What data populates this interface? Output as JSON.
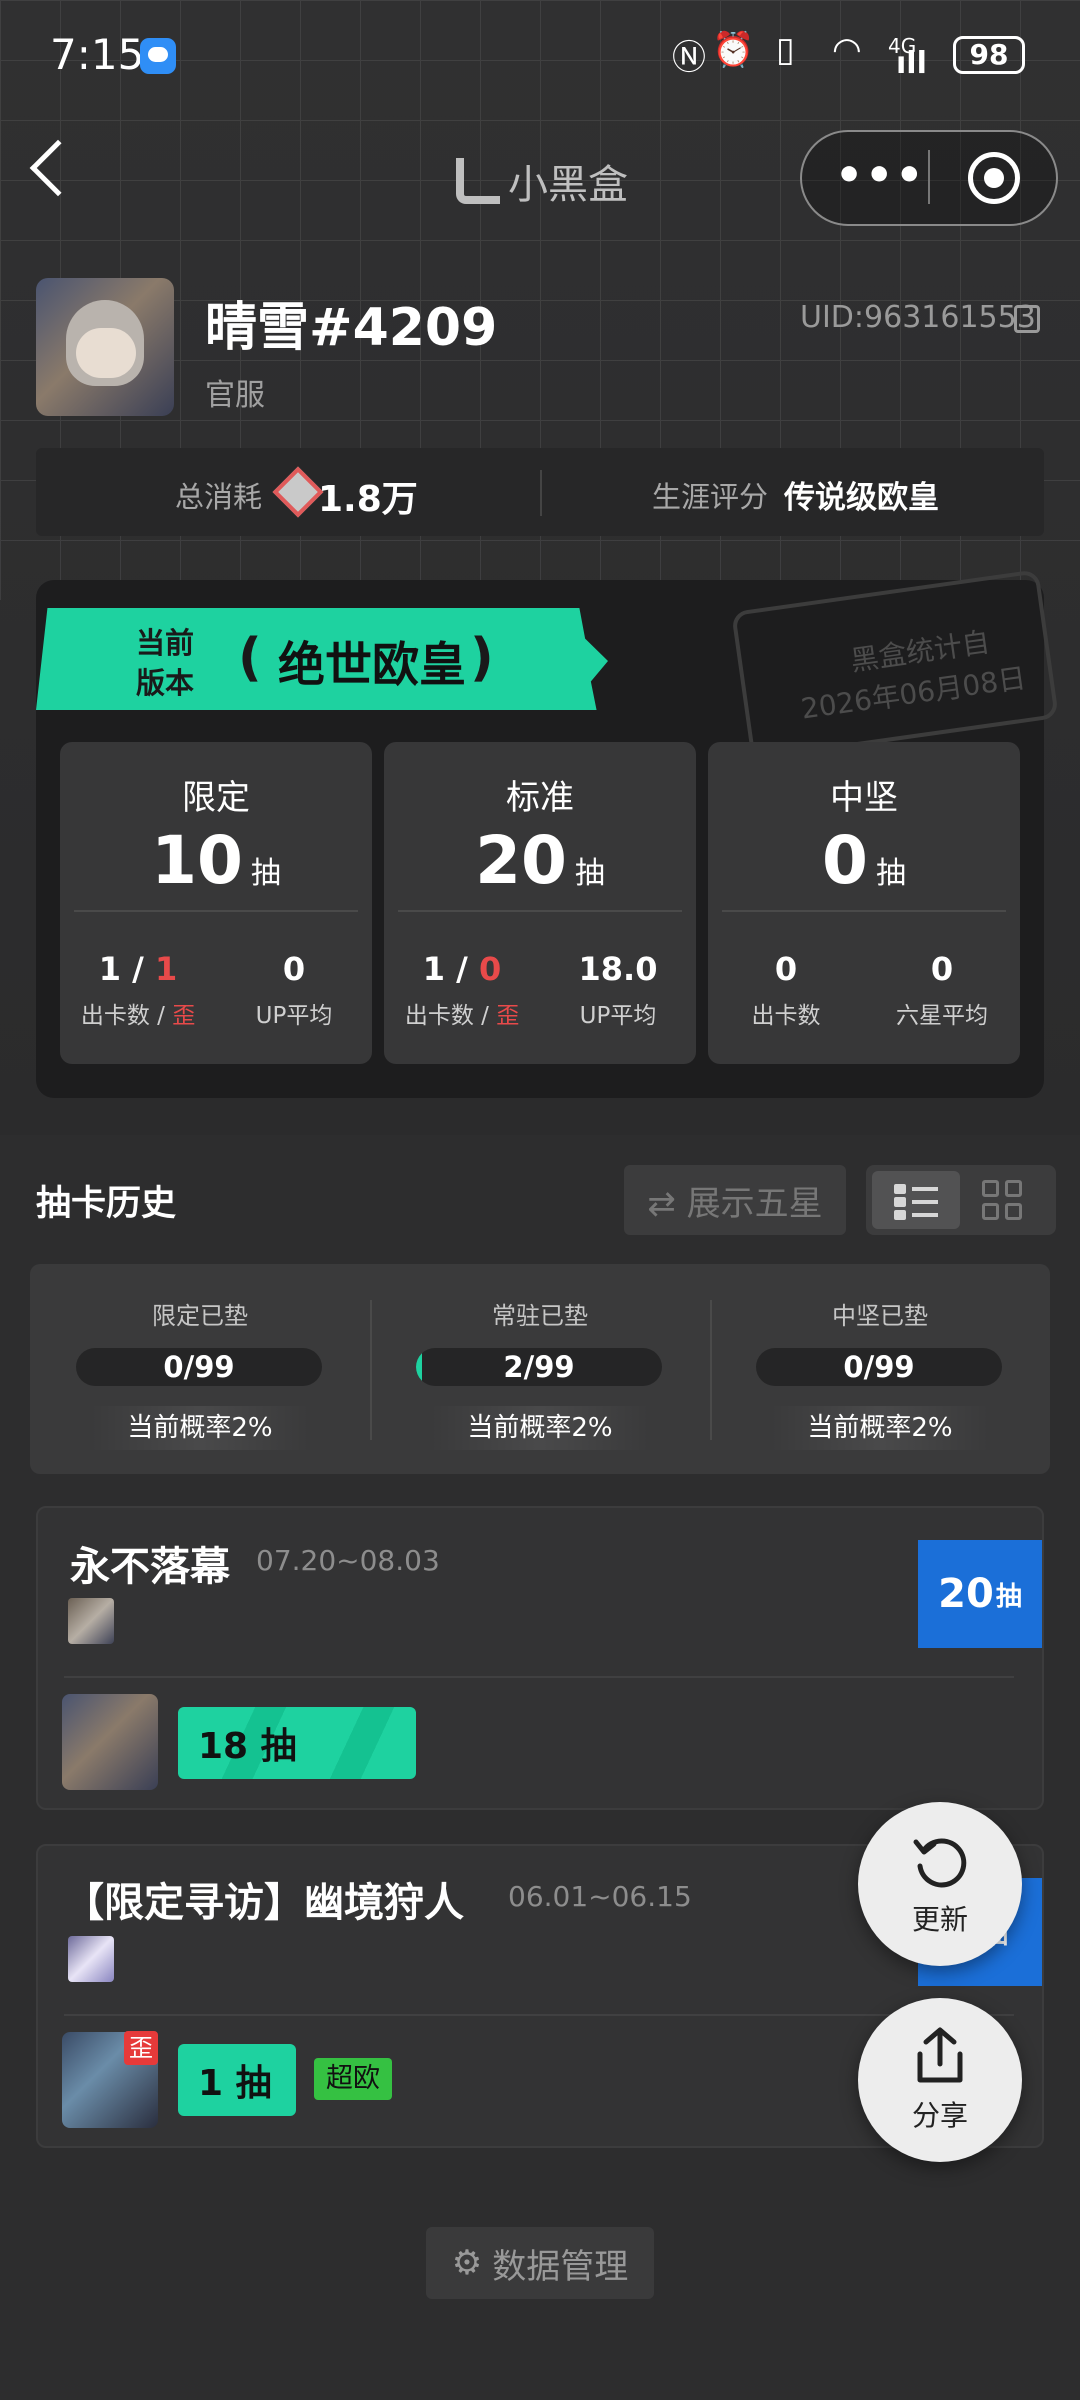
{
  "status": {
    "time": "7:15",
    "battery": "98",
    "net": "4G",
    "signal": "ıll"
  },
  "nav": {
    "title": "小黑盒",
    "more": "•••"
  },
  "profile": {
    "name": "晴雪#4209",
    "server": "官服",
    "uid": "UID:963161553"
  },
  "summary": {
    "cost_label": "总消耗",
    "cost_value": "1.8万",
    "career_label": "生涯评分",
    "career_value": "传说级欧皇"
  },
  "version": {
    "label_line1": "当前",
    "label_line2": "版本",
    "title": "绝世欧皇",
    "stamp_line1": "黑盒统计自",
    "stamp_line2": "2026年06月08日"
  },
  "pools": [
    {
      "name": "限定",
      "pulls": "10",
      "unit": "抽",
      "a_val": "1",
      "a_sep": " / ",
      "a_red": "1",
      "a_cap": "出卡数 / ",
      "a_cap_red": "歪",
      "b_val": "0",
      "b_cap": "UP平均"
    },
    {
      "name": "标准",
      "pulls": "20",
      "unit": "抽",
      "a_val": "1",
      "a_sep": " / ",
      "a_red": "0",
      "a_cap": "出卡数 / ",
      "a_cap_red": "歪",
      "b_val": "18.0",
      "b_cap": "UP平均"
    },
    {
      "name": "中坚",
      "pulls": "0",
      "unit": "抽",
      "a_val": "0",
      "a_sep": "",
      "a_red": "",
      "a_cap": "出卡数",
      "a_cap_red": "",
      "b_val": "0",
      "b_cap": "六星平均"
    }
  ],
  "history": {
    "title": "抽卡历史",
    "show_five": "⇄ 展示五星",
    "data_manage": "数据管理"
  },
  "pity": [
    {
      "label": "限定已垫",
      "value": "0/99",
      "progress": 0,
      "rate": "当前概率2%"
    },
    {
      "label": "常驻已垫",
      "value": "2/99",
      "progress": 0.02,
      "rate": "当前概率2%"
    },
    {
      "label": "中坚已垫",
      "value": "0/99",
      "progress": 0,
      "rate": "当前概率2%"
    }
  ],
  "banners": [
    {
      "title": "永不落幕",
      "dates": "07.20~08.03",
      "total": "20",
      "unit": "抽",
      "pull_count": "18 抽"
    },
    {
      "title": "【限定寻访】幽境狩人",
      "dates": "06.01~06.15",
      "total": "0",
      "unit": "抽",
      "pull_count": "1 抽",
      "tag": "超欧",
      "badge": "歪"
    }
  ],
  "fab": {
    "refresh": "更新",
    "share": "分享"
  },
  "colors": {
    "accent": "#1ed2a0",
    "red": "#e84a4a",
    "blue": "#1b6fd8"
  }
}
